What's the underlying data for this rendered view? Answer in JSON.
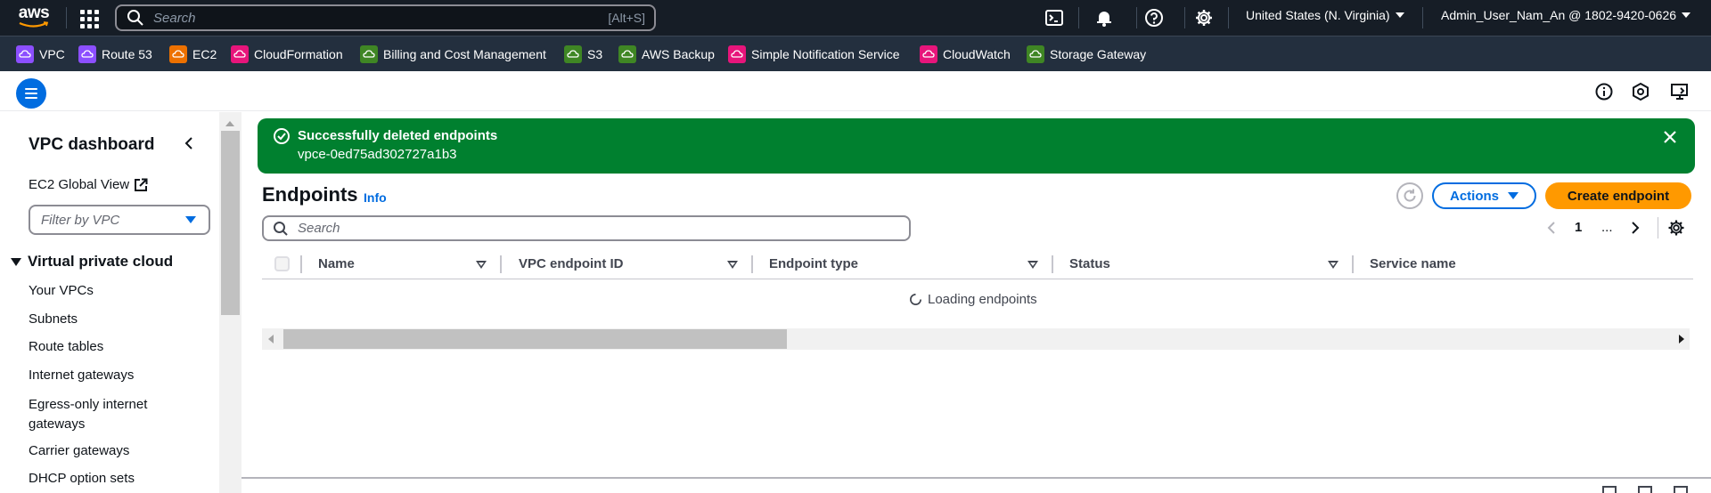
{
  "topnav": {
    "logo_text": "aws",
    "search_placeholder": "Search",
    "search_hint": "[Alt+S]",
    "region": "United States (N. Virginia)",
    "account": "Admin_User_Nam_An @ 1802-9420-0626",
    "icons": [
      "cloudshell-icon",
      "bell-icon",
      "help-icon",
      "gear-icon"
    ]
  },
  "favorites": [
    {
      "label": "VPC",
      "color": "#8c4fff"
    },
    {
      "label": "Route 53",
      "color": "#8c4fff"
    },
    {
      "label": "EC2",
      "color": "#ed7100"
    },
    {
      "label": "CloudFormation",
      "color": "#e7157b"
    },
    {
      "label": "Billing and Cost Management",
      "color": "#3f8624"
    },
    {
      "label": "S3",
      "color": "#3f8624"
    },
    {
      "label": "AWS Backup",
      "color": "#3f8624"
    },
    {
      "label": "Simple Notification Service",
      "color": "#e7157b"
    },
    {
      "label": "CloudWatch",
      "color": "#e7157b"
    },
    {
      "label": "Storage Gateway",
      "color": "#3f8624"
    }
  ],
  "sidebar": {
    "title": "VPC dashboard",
    "ec2_global_view": "EC2 Global View",
    "filter_placeholder": "Filter by VPC",
    "section": "Virtual private cloud",
    "items": [
      "Your VPCs",
      "Subnets",
      "Route tables",
      "Internet gateways",
      "Egress-only internet gateways",
      "Carrier gateways",
      "DHCP option sets"
    ]
  },
  "flash": {
    "heading": "Successfully deleted endpoints",
    "body": "vpce-0ed75ad302727a1b3",
    "color": "#00802f"
  },
  "main": {
    "title": "Endpoints",
    "info": "Info",
    "actions_label": "Actions",
    "create_label": "Create endpoint",
    "search_placeholder": "Search",
    "page_number": "1",
    "page_more": "...",
    "columns": [
      "Name",
      "VPC endpoint ID",
      "Endpoint type",
      "Status",
      "Service name"
    ],
    "loading_text": "Loading endpoints"
  }
}
